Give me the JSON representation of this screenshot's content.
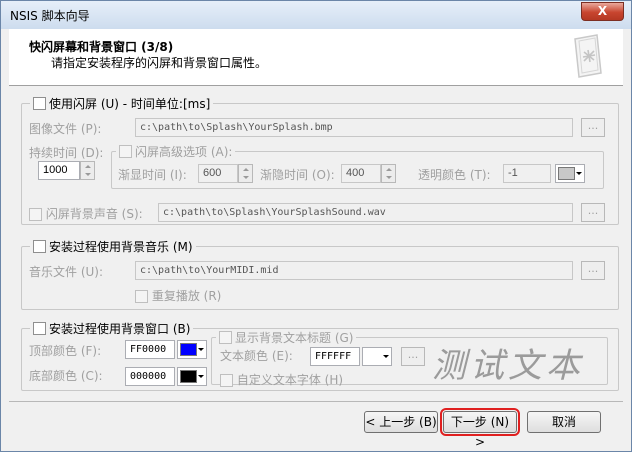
{
  "window": {
    "title": "NSIS 脚本向导",
    "close_glyph": "X"
  },
  "header": {
    "title": "快闪屏幕和背景窗口 (3/8)",
    "subtitle": "请指定安装程序的闪屏和背景窗口属性。",
    "icon": "wizard-page-icon"
  },
  "splash": {
    "label": "使用闪屏 (U) - 时间单位:[ms]",
    "image_label": "图像文件 (P):",
    "image_path": "c:\\path\\to\\Splash\\YourSplash.bmp",
    "duration_label": "持续时间 (D):",
    "duration_value": "1000",
    "advanced_label": "闪屏高级选项 (A):",
    "fadein_label": "渐显时间 (I):",
    "fadein_value": "600",
    "fadeout_label": "渐隐时间 (O):",
    "fadeout_value": "400",
    "transparent_label": "透明颜色 (T):",
    "transparent_value": "-1",
    "sound_label": "闪屏背景声音 (S):",
    "sound_path": "c:\\path\\to\\Splash\\YourSplashSound.wav",
    "browse_label": "..."
  },
  "music": {
    "label": "安装过程使用背景音乐 (M)",
    "file_label": "音乐文件 (U):",
    "file_path": "c:\\path\\to\\YourMIDI.mid",
    "repeat_label": "重复播放 (R)",
    "browse_label": "..."
  },
  "bgwindow": {
    "label": "安装过程使用背景窗口 (B)",
    "top_color_label": "顶部颜色 (F):",
    "top_color_value": "FF0000",
    "top_color_swatch": "#0000ff",
    "bottom_color_label": "底部颜色 (C):",
    "bottom_color_value": "000000",
    "bottom_color_swatch": "#000000",
    "show_title_label": "显示背景文本标题 (G)",
    "text_color_label": "文本颜色 (E):",
    "text_color_value": "FFFFFF",
    "text_color_swatch": "#ffffff",
    "custom_font_label": "自定义文本字体 (H)",
    "preview_text": "测试文本",
    "browse_label": "..."
  },
  "buttons": {
    "back": "< 上一步 (B)",
    "next": "下一步 (N) >",
    "cancel": "取消"
  },
  "colors": {
    "highlight": "#e02020",
    "disabled_text": "#a0a0a0"
  }
}
